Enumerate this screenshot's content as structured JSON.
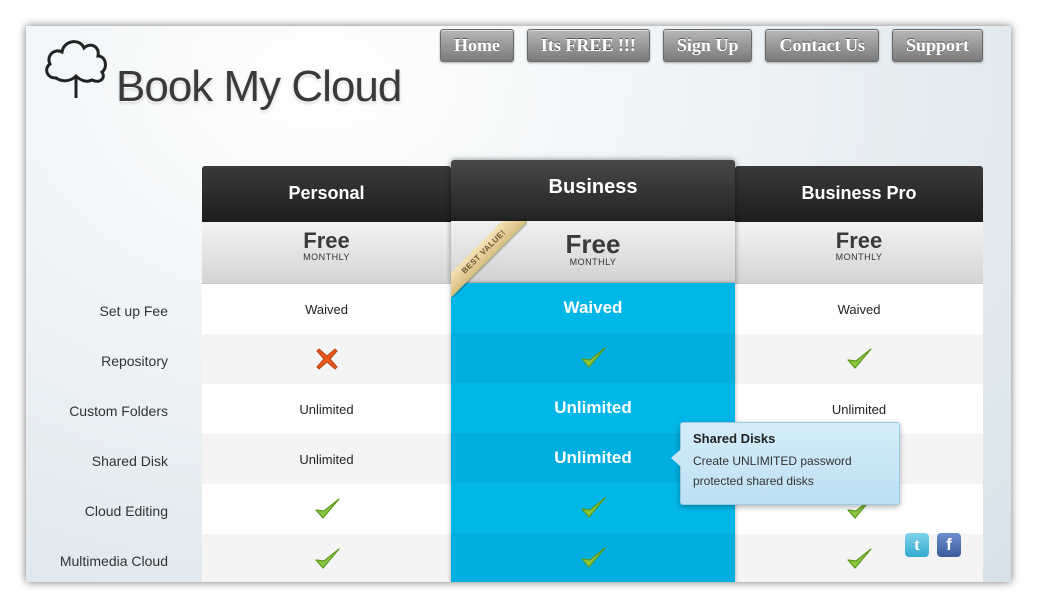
{
  "brand": {
    "name": "Book My Cloud",
    "logo_icon": "cloud-icon"
  },
  "nav": [
    {
      "label": "Home"
    },
    {
      "label": "Its FREE !!!"
    },
    {
      "label": "Sign Up"
    },
    {
      "label": "Contact Us"
    },
    {
      "label": "Support"
    }
  ],
  "features": [
    "Set up Fee",
    "Repository",
    "Custom Folders",
    "Shared Disk",
    "Cloud Editing",
    "Multimedia Cloud"
  ],
  "plans": [
    {
      "name": "Personal",
      "price": "Free",
      "period": "MONTHLY",
      "values": [
        "Waived",
        "cross",
        "Unlimited",
        "Unlimited",
        "check",
        "check"
      ]
    },
    {
      "name": "Business",
      "price": "Free",
      "period": "MONTHLY",
      "badge": "BEST VALUE!",
      "values": [
        "Waived",
        "check",
        "Unlimited",
        "Unlimited",
        "check",
        "check"
      ]
    },
    {
      "name": "Business Pro",
      "price": "Free",
      "period": "MONTHLY",
      "values": [
        "Waived",
        "check",
        "Unlimited",
        "",
        "check",
        "check"
      ]
    }
  ],
  "tooltip": {
    "title": "Shared Disks",
    "text": "Create UNLIMITED password protected shared disks"
  },
  "social": {
    "twitter_glyph": "t",
    "facebook_glyph": "f"
  },
  "colors": {
    "highlight": "#00b7e8",
    "check": "#8cc63f",
    "cross": "#e8581c",
    "header": "#2a2a2a"
  }
}
